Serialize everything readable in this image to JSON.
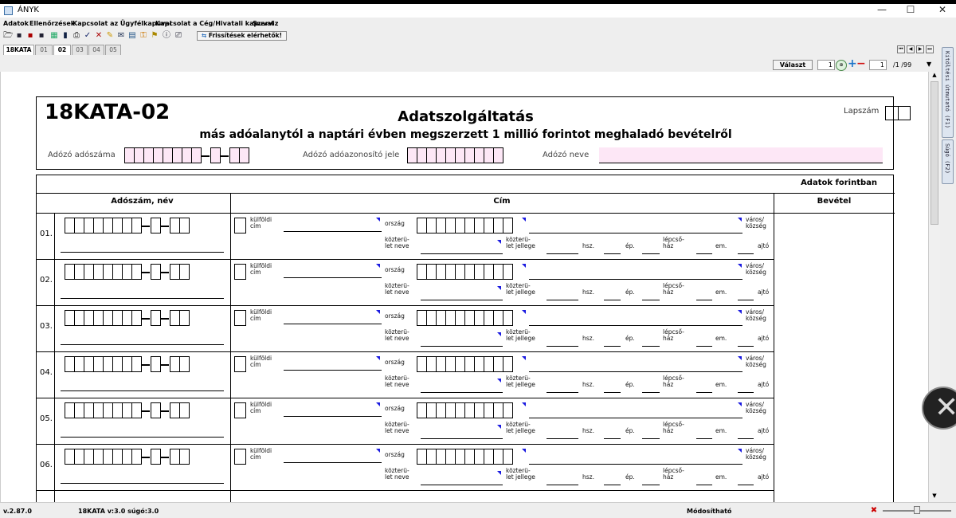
{
  "window": {
    "title": "ÁNYK",
    "minimize": "—",
    "maximize": "☐",
    "close": "✕"
  },
  "menubar": {
    "items": [
      "Adatok",
      "Ellenőrzések",
      "Kapcsolat az Ügyfélkapuval",
      "Kapcsolat a Cég/Hivatali kapuval",
      "Szerviz"
    ]
  },
  "toolbar": {
    "update_label": "Frissítések elérhetők!"
  },
  "tabs": [
    "18KATA",
    "01",
    "02",
    "03",
    "04",
    "05"
  ],
  "active_tab": "02",
  "controls": {
    "valaszt_label": "Választ",
    "page_value": "1",
    "copy_value": "1",
    "copy_count": "/1 /99"
  },
  "side_tabs": [
    "Kitöltési útmutató (F1)",
    "Súgó (F2)"
  ],
  "form": {
    "code": "18KATA-02",
    "title": "Adatszolgáltatás",
    "subtitle": "más adóalanytól a naptári évben megszerzett 1 millió forintot meghaladó bevételről",
    "lapszam_label": "Lapszám",
    "adoszam_label": "Adózó adószáma",
    "adoazonosito_label": "Adózó adóazonosító jele",
    "nev_label": "Adózó neve",
    "currency_note": "Adatok forintban",
    "col_adoszam": "Adószám,  név",
    "col_cim": "Cím",
    "col_bevetel": "Bevétel",
    "labels": {
      "kulfoldi": "külföldi\ncím",
      "orszag": "ország",
      "varos": "város/\nközség",
      "kozterulet_neve": "közterü-\nlet neve",
      "kozterulet_jellege": "közterü-\nlet jellege",
      "hsz": "hsz.",
      "ep": "ép.",
      "lepcsohaz": "lépcső-\nház",
      "em": "em.",
      "ajto": "ajtó"
    },
    "rows": [
      "01.",
      "02.",
      "03.",
      "04.",
      "05.",
      "06."
    ]
  },
  "status": {
    "version": "v.2.87.0",
    "form_version": "18KATA v:3.0 súgó:3.0",
    "mode": "Módosítható"
  },
  "colors": {
    "pink_field": "#fde7f6",
    "marker_blue": "#1a1ae0"
  }
}
